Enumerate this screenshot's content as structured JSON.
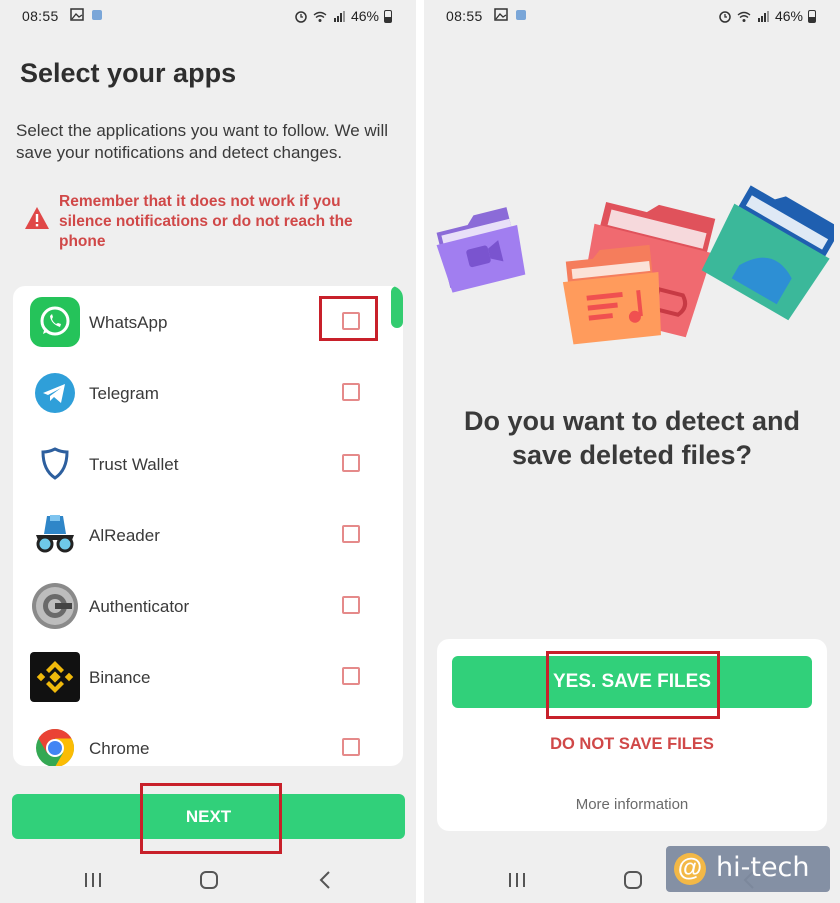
{
  "left_screen": {
    "status_bar": {
      "time": "08:55",
      "battery": "46%"
    },
    "title": "Select your apps",
    "description": "Select the applications you want to follow. We will save your notifications and detect changes.",
    "warning": "Remember that it does not work if you silence notifications or do not reach the phone",
    "apps": [
      {
        "name": "WhatsApp",
        "icon": "whatsapp-icon",
        "checked": false
      },
      {
        "name": "Telegram",
        "icon": "telegram-icon",
        "checked": false
      },
      {
        "name": "Trust Wallet",
        "icon": "trust-wallet-icon",
        "checked": false
      },
      {
        "name": "AlReader",
        "icon": "alreader-icon",
        "checked": false
      },
      {
        "name": "Authenticator",
        "icon": "authenticator-icon",
        "checked": false
      },
      {
        "name": "Binance",
        "icon": "binance-icon",
        "checked": false
      },
      {
        "name": "Chrome",
        "icon": "chrome-icon",
        "checked": false
      }
    ],
    "next_label": "NEXT"
  },
  "right_screen": {
    "status_bar": {
      "time": "08:55",
      "battery": "46%"
    },
    "question": "Do you want to detect and save deleted files?",
    "yes_label": "YES. SAVE FILES",
    "no_label": "DO NOT SAVE FILES",
    "more_info_label": "More information"
  },
  "watermark": {
    "text": "hi-tech"
  },
  "colors": {
    "accent_green": "#31d07a",
    "warning_red": "#d04848",
    "highlight_red": "#c8202a"
  }
}
